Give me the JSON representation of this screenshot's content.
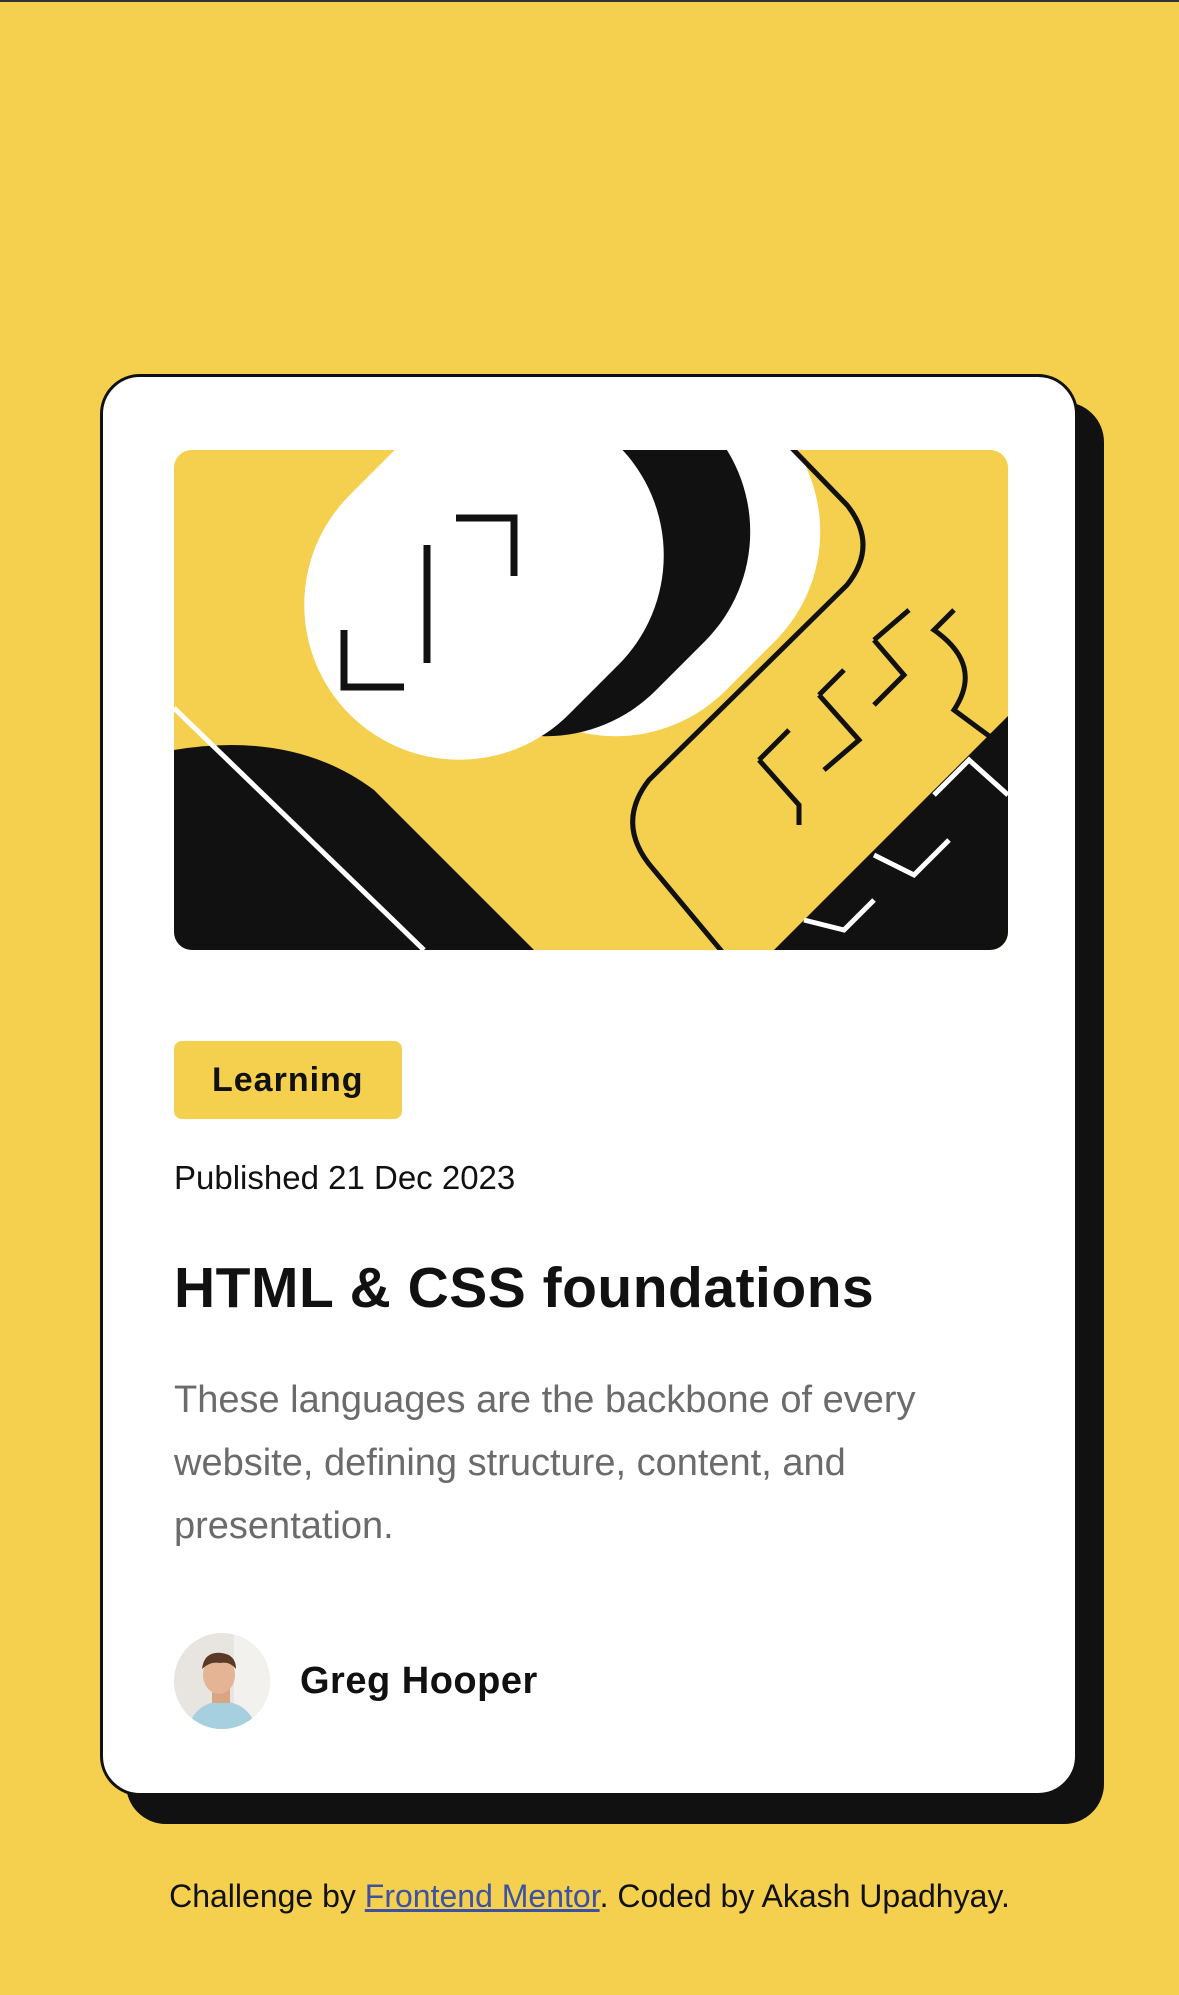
{
  "card": {
    "tag": "Learning",
    "published": "Published 21 Dec 2023",
    "title": "HTML & CSS foundations",
    "description": "These languages are the backbone of every website, defining structure, content, and presentation.",
    "author": {
      "name": "Greg Hooper"
    }
  },
  "footer": {
    "prefix": "Challenge by ",
    "link_text": "Frontend Mentor",
    "suffix": ". Coded by Akash Upadhyay."
  },
  "colors": {
    "background": "#f4d04e",
    "card": "#ffffff",
    "ink": "#111111",
    "muted_text": "#6b6b6b",
    "link": "#3e52a3"
  }
}
